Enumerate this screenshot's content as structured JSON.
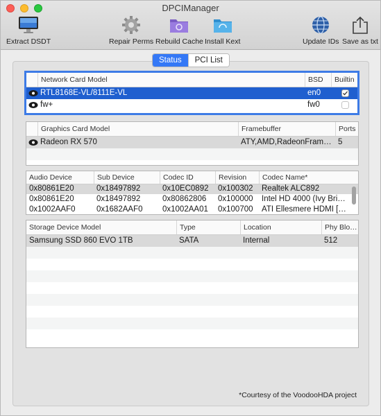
{
  "window": {
    "title": "DPCIManager"
  },
  "toolbar": {
    "extract": "Extract DSDT",
    "repair": "Repair Perms",
    "rebuild": "Rebuild Cache",
    "install": "Install Kext",
    "update": "Update IDs",
    "save": "Save as txt"
  },
  "tabs": {
    "status": "Status",
    "pci": "PCI List",
    "selected": "Status"
  },
  "network": {
    "headers": [
      "Network Card Model",
      "BSD",
      "Builtin"
    ],
    "rows": [
      {
        "model": "RTL8168E-VL/8111E-VL",
        "bsd": "en0",
        "builtin": true
      },
      {
        "model": "fw+",
        "bsd": "fw0",
        "builtin": false
      }
    ]
  },
  "graphics": {
    "headers": [
      "Graphics Card Model",
      "Framebuffer",
      "Ports"
    ],
    "rows": [
      {
        "model": "Radeon RX 570",
        "framebuffer": "ATY,AMD,RadeonFrame…",
        "ports": "5"
      }
    ]
  },
  "audio": {
    "headers": [
      "Audio Device",
      "Sub Device",
      "Codec ID",
      "Revision",
      "Codec Name*"
    ],
    "rows": [
      [
        "0x80861E20",
        "0x18497892",
        "0x10EC0892",
        "0x100302",
        "Realtek ALC892"
      ],
      [
        "0x80861E20",
        "0x18497892",
        "0x80862806",
        "0x100000",
        "Intel HD 4000 (Ivy Bri…"
      ],
      [
        "0x1002AAF0",
        "0x1682AAF0",
        "0x1002AA01",
        "0x100700",
        "ATI Ellesmere HDMI […"
      ]
    ]
  },
  "storage": {
    "headers": [
      "Storage Device Model",
      "Type",
      "Location",
      "Phy Blo…"
    ],
    "rows": [
      {
        "model": "Samsung SSD 860 EVO 1TB",
        "type": "SATA",
        "location": "Internal",
        "phy": "512"
      }
    ]
  },
  "footer": "*Courtesy of the VoodooHDA project",
  "colors": {
    "selection": "#1f5fcf",
    "segment_active": "#3478f6"
  }
}
